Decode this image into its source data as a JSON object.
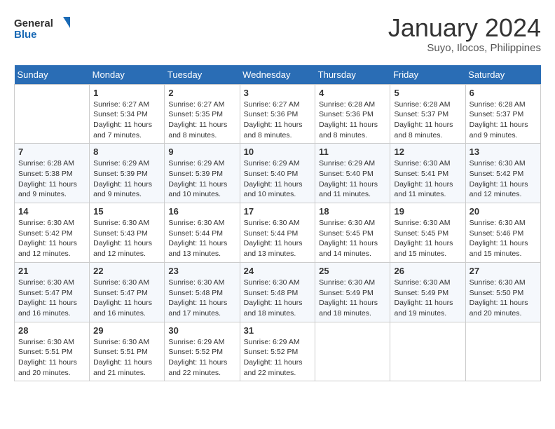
{
  "logo": {
    "line1": "General",
    "line2": "Blue"
  },
  "title": "January 2024",
  "subtitle": "Suyo, Ilocos, Philippines",
  "days_of_week": [
    "Sunday",
    "Monday",
    "Tuesday",
    "Wednesday",
    "Thursday",
    "Friday",
    "Saturday"
  ],
  "weeks": [
    [
      {
        "day": "",
        "info": ""
      },
      {
        "day": "1",
        "info": "Sunrise: 6:27 AM\nSunset: 5:34 PM\nDaylight: 11 hours\nand 7 minutes."
      },
      {
        "day": "2",
        "info": "Sunrise: 6:27 AM\nSunset: 5:35 PM\nDaylight: 11 hours\nand 8 minutes."
      },
      {
        "day": "3",
        "info": "Sunrise: 6:27 AM\nSunset: 5:36 PM\nDaylight: 11 hours\nand 8 minutes."
      },
      {
        "day": "4",
        "info": "Sunrise: 6:28 AM\nSunset: 5:36 PM\nDaylight: 11 hours\nand 8 minutes."
      },
      {
        "day": "5",
        "info": "Sunrise: 6:28 AM\nSunset: 5:37 PM\nDaylight: 11 hours\nand 8 minutes."
      },
      {
        "day": "6",
        "info": "Sunrise: 6:28 AM\nSunset: 5:37 PM\nDaylight: 11 hours\nand 9 minutes."
      }
    ],
    [
      {
        "day": "7",
        "info": "Sunrise: 6:28 AM\nSunset: 5:38 PM\nDaylight: 11 hours\nand 9 minutes."
      },
      {
        "day": "8",
        "info": "Sunrise: 6:29 AM\nSunset: 5:39 PM\nDaylight: 11 hours\nand 9 minutes."
      },
      {
        "day": "9",
        "info": "Sunrise: 6:29 AM\nSunset: 5:39 PM\nDaylight: 11 hours\nand 10 minutes."
      },
      {
        "day": "10",
        "info": "Sunrise: 6:29 AM\nSunset: 5:40 PM\nDaylight: 11 hours\nand 10 minutes."
      },
      {
        "day": "11",
        "info": "Sunrise: 6:29 AM\nSunset: 5:40 PM\nDaylight: 11 hours\nand 11 minutes."
      },
      {
        "day": "12",
        "info": "Sunrise: 6:30 AM\nSunset: 5:41 PM\nDaylight: 11 hours\nand 11 minutes."
      },
      {
        "day": "13",
        "info": "Sunrise: 6:30 AM\nSunset: 5:42 PM\nDaylight: 11 hours\nand 12 minutes."
      }
    ],
    [
      {
        "day": "14",
        "info": "Sunrise: 6:30 AM\nSunset: 5:42 PM\nDaylight: 11 hours\nand 12 minutes."
      },
      {
        "day": "15",
        "info": "Sunrise: 6:30 AM\nSunset: 5:43 PM\nDaylight: 11 hours\nand 12 minutes."
      },
      {
        "day": "16",
        "info": "Sunrise: 6:30 AM\nSunset: 5:44 PM\nDaylight: 11 hours\nand 13 minutes."
      },
      {
        "day": "17",
        "info": "Sunrise: 6:30 AM\nSunset: 5:44 PM\nDaylight: 11 hours\nand 13 minutes."
      },
      {
        "day": "18",
        "info": "Sunrise: 6:30 AM\nSunset: 5:45 PM\nDaylight: 11 hours\nand 14 minutes."
      },
      {
        "day": "19",
        "info": "Sunrise: 6:30 AM\nSunset: 5:45 PM\nDaylight: 11 hours\nand 15 minutes."
      },
      {
        "day": "20",
        "info": "Sunrise: 6:30 AM\nSunset: 5:46 PM\nDaylight: 11 hours\nand 15 minutes."
      }
    ],
    [
      {
        "day": "21",
        "info": "Sunrise: 6:30 AM\nSunset: 5:47 PM\nDaylight: 11 hours\nand 16 minutes."
      },
      {
        "day": "22",
        "info": "Sunrise: 6:30 AM\nSunset: 5:47 PM\nDaylight: 11 hours\nand 16 minutes."
      },
      {
        "day": "23",
        "info": "Sunrise: 6:30 AM\nSunset: 5:48 PM\nDaylight: 11 hours\nand 17 minutes."
      },
      {
        "day": "24",
        "info": "Sunrise: 6:30 AM\nSunset: 5:48 PM\nDaylight: 11 hours\nand 18 minutes."
      },
      {
        "day": "25",
        "info": "Sunrise: 6:30 AM\nSunset: 5:49 PM\nDaylight: 11 hours\nand 18 minutes."
      },
      {
        "day": "26",
        "info": "Sunrise: 6:30 AM\nSunset: 5:49 PM\nDaylight: 11 hours\nand 19 minutes."
      },
      {
        "day": "27",
        "info": "Sunrise: 6:30 AM\nSunset: 5:50 PM\nDaylight: 11 hours\nand 20 minutes."
      }
    ],
    [
      {
        "day": "28",
        "info": "Sunrise: 6:30 AM\nSunset: 5:51 PM\nDaylight: 11 hours\nand 20 minutes."
      },
      {
        "day": "29",
        "info": "Sunrise: 6:30 AM\nSunset: 5:51 PM\nDaylight: 11 hours\nand 21 minutes."
      },
      {
        "day": "30",
        "info": "Sunrise: 6:29 AM\nSunset: 5:52 PM\nDaylight: 11 hours\nand 22 minutes."
      },
      {
        "day": "31",
        "info": "Sunrise: 6:29 AM\nSunset: 5:52 PM\nDaylight: 11 hours\nand 22 minutes."
      },
      {
        "day": "",
        "info": ""
      },
      {
        "day": "",
        "info": ""
      },
      {
        "day": "",
        "info": ""
      }
    ]
  ]
}
